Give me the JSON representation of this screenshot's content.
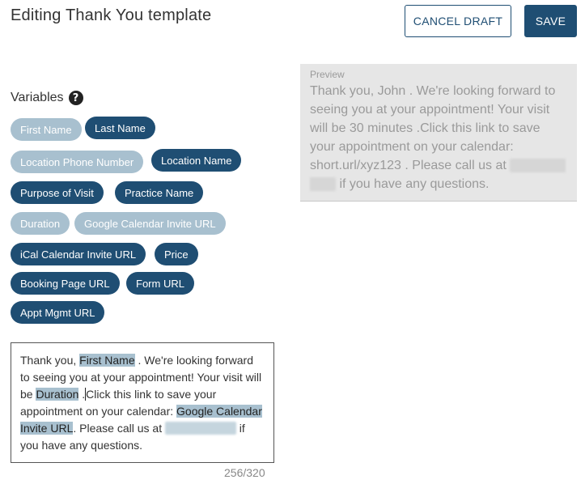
{
  "header": {
    "title": "Editing Thank You template",
    "cancel_label": "CANCEL DRAFT",
    "save_label": "SAVE"
  },
  "variables": {
    "label": "Variables",
    "help_glyph": "?",
    "items": [
      {
        "label": "First Name",
        "state": "used"
      },
      {
        "label": "Last Name",
        "state": "available"
      },
      {
        "label": "Location Phone Number",
        "state": "used"
      },
      {
        "label": "Location Name",
        "state": "available"
      },
      {
        "label": "Purpose of Visit",
        "state": "available"
      },
      {
        "label": "Practice Name",
        "state": "available"
      },
      {
        "label": "Duration",
        "state": "used"
      },
      {
        "label": "Google Calendar Invite URL",
        "state": "used"
      },
      {
        "label": "iCal Calendar Invite URL",
        "state": "available"
      },
      {
        "label": "Price",
        "state": "available"
      },
      {
        "label": "Booking Page URL",
        "state": "available"
      },
      {
        "label": "Form URL",
        "state": "available"
      },
      {
        "label": "Appt Mgmt URL",
        "state": "available"
      }
    ]
  },
  "editor": {
    "seg1": "Thank you, ",
    "chip_first_name": "First Name",
    "seg2": " . We're looking forward to seeing you at your appointment! Your visit will be ",
    "chip_duration": "Duration",
    "seg3": " .",
    "seg4": "Click this link to save your appointment on your calendar: ",
    "chip_calendar": "Google Calendar Invite URL",
    "seg5": ". Please call us at ",
    "seg6": " if you have any questions.",
    "counter": "256/320"
  },
  "preview": {
    "label": "Preview",
    "text_before": "Thank you, John . We're looking forward to seeing you at your appointment! Your visit will be 30 minutes .Click this link to save your appointment on your calendar: short.url/xyz123 . Please call us at ",
    "text_after": " if you have any questions."
  },
  "colors": {
    "primary": "#1f4e73",
    "used_variable": "#a8c0cf",
    "preview_bg": "#e6e6e6"
  }
}
